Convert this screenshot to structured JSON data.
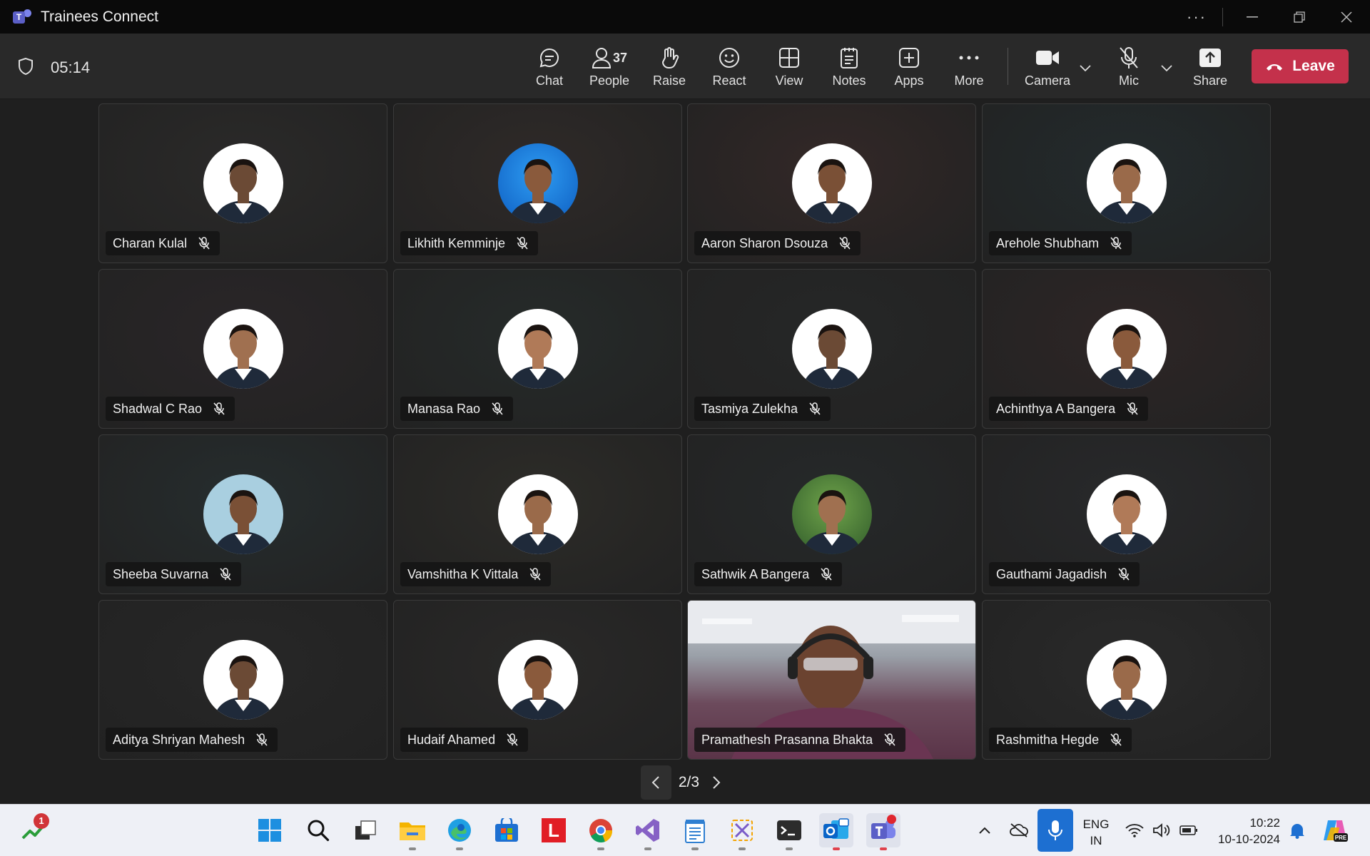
{
  "window": {
    "title": "Trainees Connect",
    "more": "···",
    "minimize": "—",
    "restore": "❐",
    "close": "✕"
  },
  "meeting": {
    "timer": "05:14",
    "people_count": "37"
  },
  "toolbar": {
    "chat": "Chat",
    "people": "People",
    "raise": "Raise",
    "react": "React",
    "view": "View",
    "notes": "Notes",
    "apps": "Apps",
    "more": "More",
    "camera": "Camera",
    "mic": "Mic",
    "share": "Share",
    "leave": "Leave"
  },
  "participants": [
    {
      "name": "Charan Kulal",
      "avatar": "photo",
      "bg": "#2b2a29"
    },
    {
      "name": "Likhith Kemminje",
      "avatar": "photo-blue",
      "bg": "#2f2a28"
    },
    {
      "name": "Aaron Sharon Dsouza",
      "avatar": "photo",
      "bg": "#332827"
    },
    {
      "name": "Arehole Shubham",
      "avatar": "photo",
      "bg": "#232b2d"
    },
    {
      "name": "Shadwal C Rao",
      "avatar": "photo",
      "bg": "#2a2628"
    },
    {
      "name": "Manasa Rao",
      "avatar": "photo",
      "bg": "#262b2a"
    },
    {
      "name": "Tasmiya Zulekha",
      "avatar": "photo",
      "bg": "#262727"
    },
    {
      "name": "Achinthya A Bangera",
      "avatar": "photo",
      "bg": "#2e2626"
    },
    {
      "name": "Sheeba Suvarna",
      "avatar": "photo",
      "bg": "#262d2e"
    },
    {
      "name": "Vamshitha K Vittala",
      "avatar": "photo",
      "bg": "#2d2c28"
    },
    {
      "name": "Sathwik A Bangera",
      "avatar": "photo-green",
      "bg": "#26292a"
    },
    {
      "name": "Gauthami Jagadish",
      "avatar": "photo",
      "bg": "#28292b"
    },
    {
      "name": "Aditya Shriyan Mahesh",
      "avatar": "photo",
      "bg": "#272727"
    },
    {
      "name": "Hudaif Ahamed",
      "avatar": "photo",
      "bg": "#2a2928"
    },
    {
      "name": "Pramathesh Prasanna Bhakta",
      "avatar": "video",
      "bg": "#5a3b4a"
    },
    {
      "name": "Rashmitha Hegde",
      "avatar": "photo",
      "bg": "#2a2a2a"
    }
  ],
  "pager": {
    "text": "2/3"
  },
  "taskbar": {
    "notification_badge": "1",
    "lang_line1": "ENG",
    "lang_line2": "IN",
    "time": "10:22",
    "date": "10-10-2024",
    "office_icon": "L"
  },
  "colors": {
    "accent": "#5b5fc7",
    "leave": "#c4314b"
  }
}
